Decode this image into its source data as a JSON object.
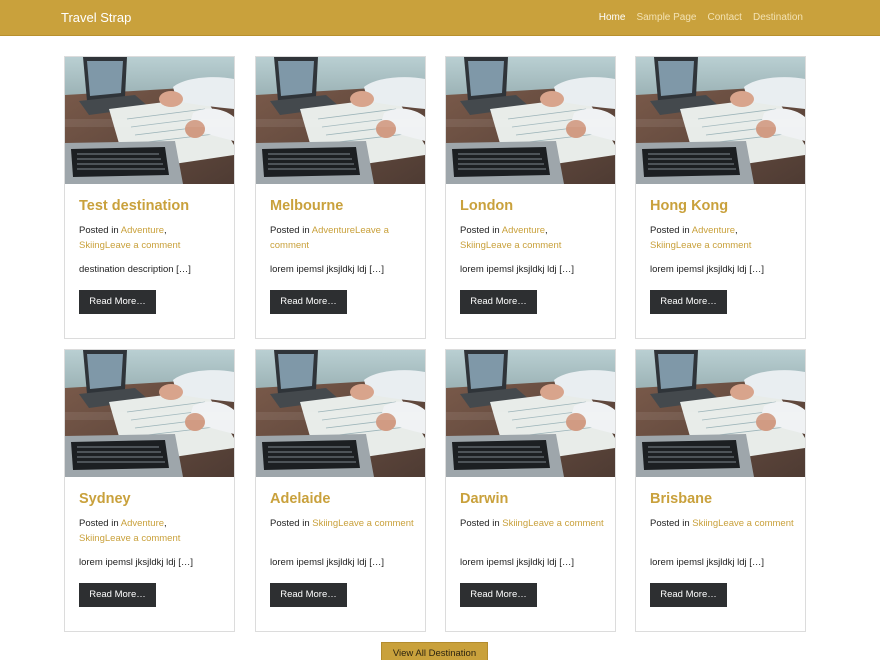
{
  "brand": "Travel Strap",
  "nav": {
    "items": [
      "Home",
      "Sample Page",
      "Contact",
      "Destination"
    ]
  },
  "posts": [
    {
      "title": "Test destination",
      "posted_in": "Posted in ",
      "cat1": "Adventure",
      "sep": ",",
      "cat2": "Skiing",
      "comment": "Leave a comment",
      "excerpt": "destination description […]",
      "read_more": "Read More…"
    },
    {
      "title": "Melbourne",
      "posted_in": "Posted in ",
      "cat1": "Adventure",
      "sep": "",
      "cat2": "",
      "comment": "Leave a comment",
      "excerpt": "lorem ipemsl jksjldkj ldj […]",
      "read_more": "Read More…"
    },
    {
      "title": "London",
      "posted_in": "Posted in ",
      "cat1": "Adventure",
      "sep": ",",
      "cat2": "Skiing",
      "comment": "Leave a comment",
      "excerpt": "lorem ipemsl jksjldkj ldj […]",
      "read_more": "Read More…"
    },
    {
      "title": "Hong Kong",
      "posted_in": "Posted in ",
      "cat1": "Adventure",
      "sep": ",",
      "cat2": "Skiing",
      "comment": "Leave a comment",
      "excerpt": "lorem ipemsl jksjldkj ldj […]",
      "read_more": "Read More…"
    },
    {
      "title": "Sydney",
      "posted_in": "Posted in ",
      "cat1": "Adventure",
      "sep": ",",
      "cat2": "Skiing",
      "comment": "Leave a comment",
      "excerpt": "lorem ipemsl jksjldkj ldj […]",
      "read_more": "Read More…"
    },
    {
      "title": "Adelaide",
      "posted_in": "Posted in ",
      "cat1": "Skiing",
      "sep": "",
      "cat2": "",
      "comment": "Leave a comment",
      "excerpt": "lorem ipemsl jksjldkj ldj […]",
      "read_more": "Read More…"
    },
    {
      "title": "Darwin",
      "posted_in": "Posted in ",
      "cat1": "Skiing",
      "sep": "",
      "cat2": "",
      "comment": "Leave a comment",
      "excerpt": "lorem ipemsl jksjldkj ldj […]",
      "read_more": "Read More…"
    },
    {
      "title": "Brisbane",
      "posted_in": "Posted in ",
      "cat1": "Skiing",
      "sep": "",
      "cat2": "",
      "comment": "Leave a comment",
      "excerpt": "lorem ipemsl jksjldkj ldj […]",
      "read_more": "Read More…"
    }
  ],
  "view_all": "View All Destination",
  "colors": {
    "accent": "#c9a13c",
    "button_dark": "#2d2f31"
  },
  "icons": {
    "thumbnail": "laptop-desk-photo"
  }
}
